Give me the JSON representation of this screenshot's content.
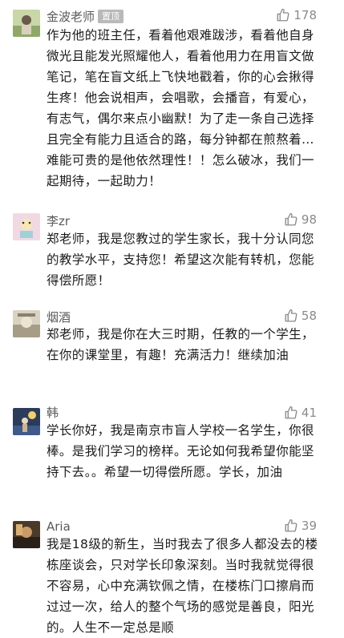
{
  "badges": {
    "pinned": "置顶"
  },
  "comments": [
    {
      "author": "金波老师",
      "likes": "178",
      "text": "作为他的班主任，看着他艰难跋涉，看着他自身微光且能发光照耀他人，看着他用力在用盲文做笔记，笔在盲文纸上飞快地戳着，你的心会揪得生疼！他会说相声，会唱歌，会播音，有爱心，有志气，偶尔来点小幽默！为了走一条自己选择且完全有能力且适合的路，每分钟都在煎熬着…难能可贵的是他依然理性！！怎么破冰，我们一起期待，一起助力！"
    },
    {
      "author": "李zr",
      "likes": "98",
      "text": "郑老师，我是您教过的学生家长，我十分认同您的教学水平，支持您！希望这次能有转机，您能得偿所愿！"
    },
    {
      "author": "烟酒",
      "likes": "58",
      "text": "郑老师，我是你在大三时期，任教的一个学生，在你的课堂里，有趣！充满活力！继续加油"
    },
    {
      "author": "韩",
      "likes": "41",
      "text": "学长你好，我是南京市盲人学校一名学生，你很棒。是我们学习的榜样。无论如何我希望你能坚持下去。。希望一切得偿所愿。学长，加油"
    },
    {
      "author": "Aria",
      "likes": "39",
      "text": "我是18级的新生，当时我去了很多人都没去的楼栋座谈会，只对学长印象深刻。当时我就觉得很不容易，心中充满钦佩之情，在楼栋门口擦肩而过过一次，给人的整个气场的感觉是善良，阳光的。人生不一定总是顺"
    }
  ]
}
